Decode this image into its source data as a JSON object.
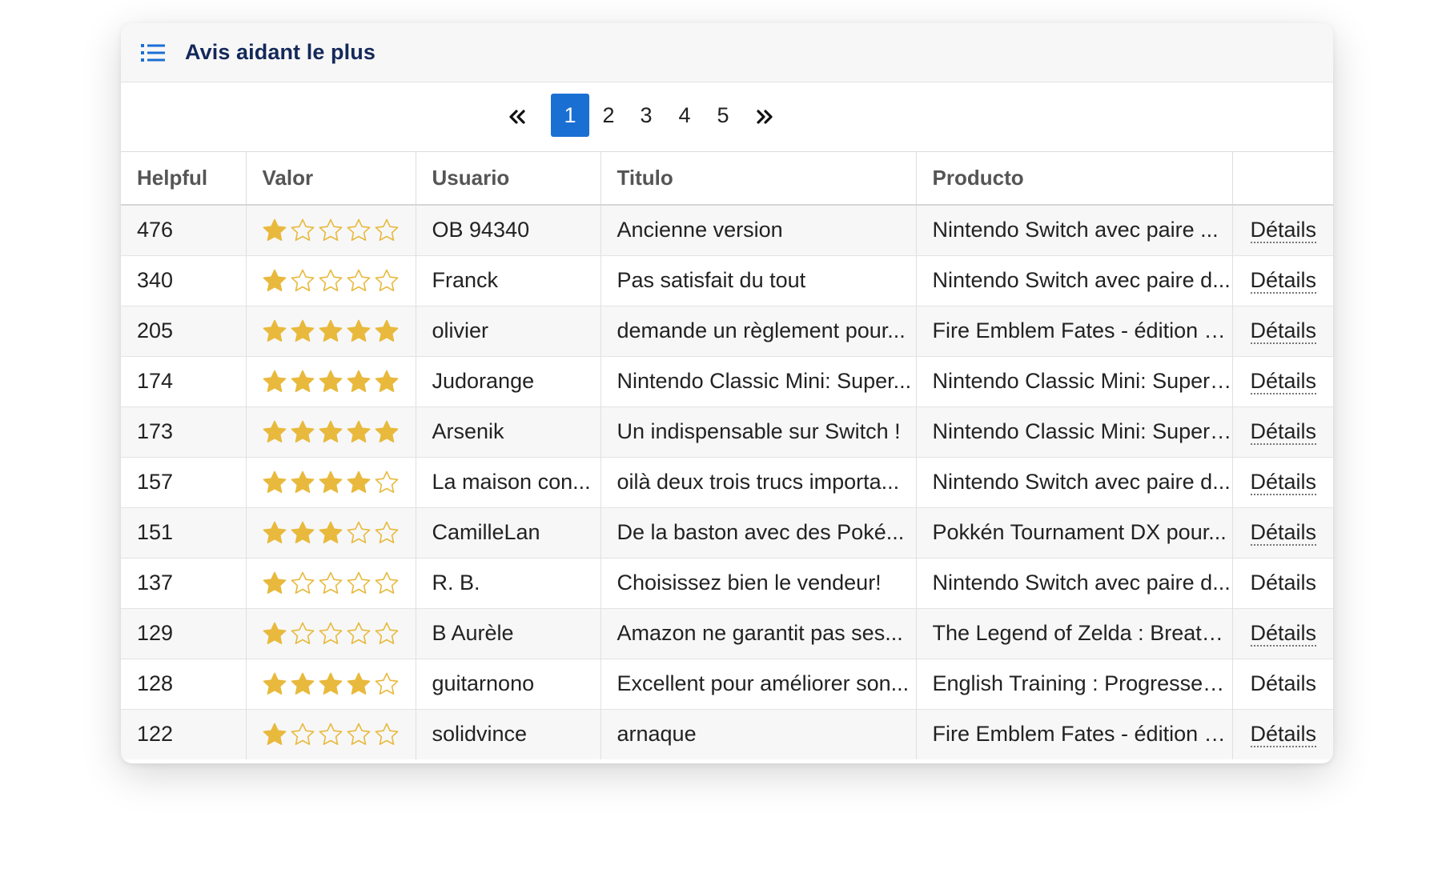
{
  "header": {
    "icon": "list-icon",
    "title": "Avis aidant le plus"
  },
  "pagination": {
    "first_icon": "double-chevron-left-icon",
    "last_icon": "double-chevron-right-icon",
    "pages": [
      "1",
      "2",
      "3",
      "4",
      "5"
    ],
    "active_page": "1"
  },
  "table": {
    "columns": [
      "Helpful",
      "Valor",
      "Usuario",
      "Titulo",
      "Producto",
      ""
    ],
    "star_max": 5,
    "star_color": "#e8b93c",
    "rows": [
      {
        "helpful": "476",
        "rating": 1,
        "user": "OB 94340",
        "title": "Ancienne version",
        "product": "Nintendo Switch avec paire ...",
        "details": "Détails",
        "dotted": true
      },
      {
        "helpful": "340",
        "rating": 1,
        "user": "Franck",
        "title": "Pas satisfait du tout",
        "product": "Nintendo Switch avec paire d...",
        "details": "Détails",
        "dotted": true
      },
      {
        "helpful": "205",
        "rating": 5,
        "user": "olivier",
        "title": "demande un règlement pour...",
        "product": "Fire Emblem Fates - édition L...",
        "details": "Détails",
        "dotted": true
      },
      {
        "helpful": "174",
        "rating": 5,
        "user": "Judorange",
        "title": "Nintendo Classic Mini: Super...",
        "product": "Nintendo Classic Mini: Super ...",
        "details": "Détails",
        "dotted": true
      },
      {
        "helpful": "173",
        "rating": 5,
        "user": "Arsenik",
        "title": "Un indispensable sur Switch !",
        "product": "Nintendo Classic Mini: Super ...",
        "details": "Détails",
        "dotted": true
      },
      {
        "helpful": "157",
        "rating": 4,
        "user": "La maison con...",
        "title": "oilà deux trois trucs importa...",
        "product": "Nintendo Switch avec paire d...",
        "details": "Détails",
        "dotted": true
      },
      {
        "helpful": "151",
        "rating": 3,
        "user": "CamilleLan",
        "title": "De la baston avec des Poké...",
        "product": "Pokkén Tournament DX pour...",
        "details": "Détails",
        "dotted": true
      },
      {
        "helpful": "137",
        "rating": 1,
        "user": "R. B.",
        "title": "Choisissez bien le vendeur!",
        "product": "Nintendo Switch avec paire d...",
        "details": "Détails",
        "dotted": false
      },
      {
        "helpful": "129",
        "rating": 1,
        "user": "B Aurèle",
        "title": "Amazon ne garantit pas ses...",
        "product": "The Legend of Zelda : Breath ...",
        "details": "Détails",
        "dotted": true
      },
      {
        "helpful": "128",
        "rating": 4,
        "user": "guitarnono",
        "title": "Excellent pour améliorer son...",
        "product": "English Training : Progressez ...",
        "details": "Détails",
        "dotted": false
      },
      {
        "helpful": "122",
        "rating": 1,
        "user": "solidvince",
        "title": "arnaque",
        "product": "Fire Emblem Fates - édition L...",
        "details": "Détails",
        "dotted": true
      }
    ]
  }
}
